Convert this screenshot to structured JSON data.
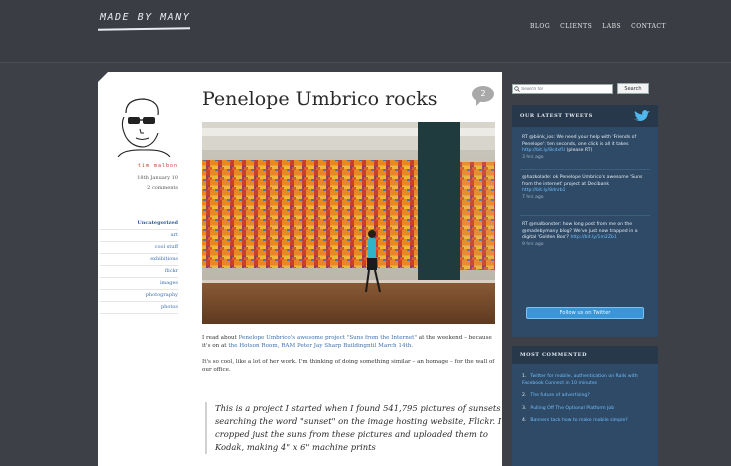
{
  "header": {
    "logo": "MADE BY MANY",
    "nav": [
      "BLOG",
      "CLIENTS",
      "LABS",
      "CONTACT"
    ]
  },
  "post": {
    "title": "Penelope Umbrico rocks",
    "comment_count": "2",
    "author": "tim malbon",
    "date": "18th January 10",
    "comments_link": "2 comments",
    "categories": [
      "Uncategorized",
      "art",
      "cool stuff",
      "exhibitions",
      "flickr",
      "images",
      "photography",
      "photos"
    ],
    "paragraph1": {
      "pre": "I read about ",
      "link1": "Penelope Umbrico's awesome project \"Suns from the Internet\"",
      "mid": " at the weekend – because it's on at ",
      "link2": "the Hotson Room, RAM Peter Jay Sharp Buildingntil March 14th.",
      "post": ""
    },
    "paragraph2": "It's so cool, like a lot of her work. I'm thinking of doing something similar – an homage – for the wall of our office.",
    "quote": "This is a project I started when I found 541,795 pictures of sunsets searching the word \"sunset\" on the image hosting website, Flickr. I cropped just the suns from these pictures and uploaded them to Kodak, making 4\" x 6\" machine prints"
  },
  "sidebar": {
    "search_placeholder": "Search for",
    "search_button": "Search",
    "tweets_title": "OUR LATEST TWEETS",
    "tweets": [
      {
        "text": "RT @biink_ios: We need your help with 'Friends of Penelope': ten seconds, one click is all it takes ",
        "link": "http://bit.ly/8cdxfU",
        "after": " (please RT)",
        "time": "3 hrs ago"
      },
      {
        "text": "@hazkolade: ok Penelope Umbrico's awesome 'Suns from the internet' project at Decibank ",
        "link": "http://bit.ly/8dnrb1",
        "after": "",
        "time": "7 hrs ago"
      },
      {
        "text": "RT @malbonster: how long post from me on the @madebymany blog? We've just now trapped in a digital 'Golden Box'? ",
        "link": "http://bit.ly/1m2Zb1",
        "after": "",
        "time": "9 hrs ago"
      }
    ],
    "follow_label": "Follow us on Twitter",
    "most_title": "MOST COMMENTED",
    "most": [
      "Twitter for mobile, authentication on Rails with Facebook Connect in 10 minutes",
      "The future of advertising?",
      "Pulling Off The Optional Platform Job",
      "Banners tack how to make mobile simple?"
    ]
  }
}
